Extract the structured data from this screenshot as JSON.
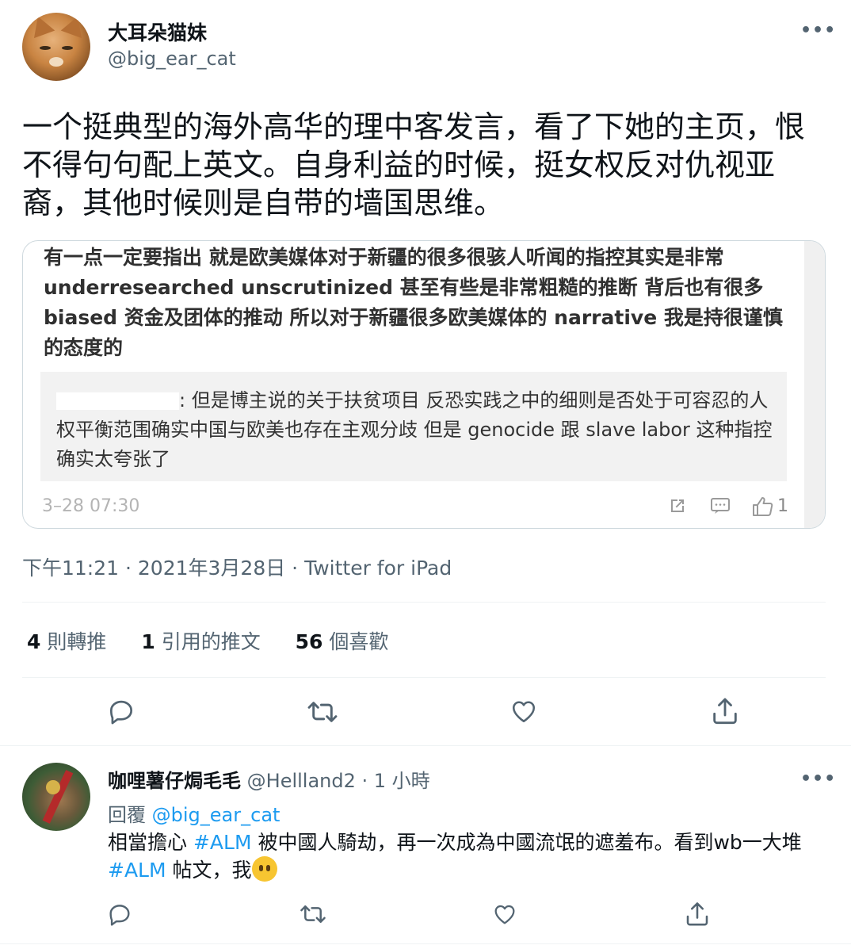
{
  "tweet": {
    "display_name": "大耳朵猫妹",
    "handle": "@big_ear_cat",
    "more_label": "•••",
    "text": "一个挺典型的海外高华的理中客发言，看了下她的主页，恨不得句句配上英文。自身利益的时候，挺女权反对仇视亚裔，其他时候则是自带的墙国思维。",
    "quoted_image": {
      "main_text": "有一点一定要指出 就是欧美媒体对于新疆的很多很骇人听闻的指控其实是非常 underresearched unscrutinized 甚至有些是非常粗糙的推断 背后也有很多 biased 资金及团体的推动 所以对于新疆很多欧美媒体的 narrative 我是持很谨慎的态度的",
      "reply_text": ": 但是博主说的关于扶贫项目 反恐实践之中的细则是否处于可容忍的人权平衡范围确实中国与欧美也存在主观分歧 但是 genocide 跟 slave labor 这种指控确实太夸张了",
      "timestamp": "3–28 07:30",
      "like_count": "1"
    },
    "meta": "下午11:21 · 2021年3月28日 · Twitter for iPad",
    "stats": {
      "retweets_count": "4",
      "retweets_label": "則轉推",
      "quotes_count": "1",
      "quotes_label": "引用的推文",
      "likes_count": "56",
      "likes_label": "個喜歡"
    }
  },
  "reply": {
    "display_name": "咖哩薯仔焗毛毛",
    "handle_time": "@Hellland2 · 1 小時",
    "more_label": "•••",
    "replying_prefix": "回覆",
    "replying_to": "@big_ear_cat",
    "body_part1": "相當擔心",
    "hashtag1": "#ALM",
    "body_part2": "被中國人騎劫，再一次成為中國流氓的遮羞布。看到wb一大堆",
    "hashtag2": "#ALM",
    "body_part3": "帖文，我"
  },
  "colors": {
    "accent": "#1d9bf0",
    "secondary_text": "#536471",
    "border": "#eff3f4"
  }
}
